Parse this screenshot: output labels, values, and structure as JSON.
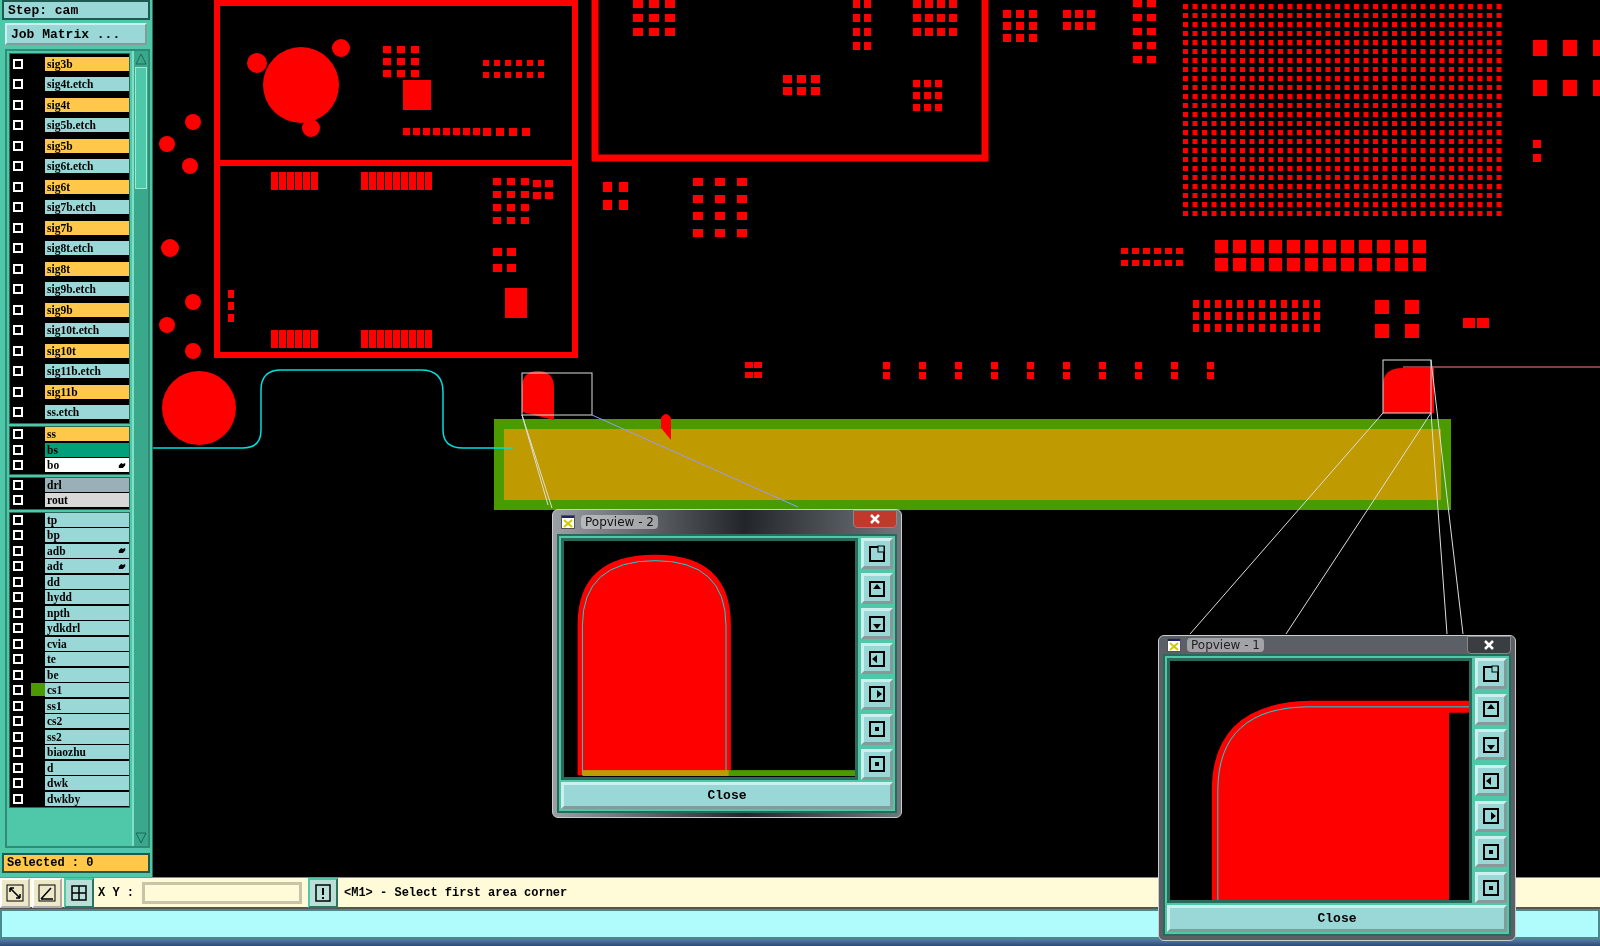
{
  "step_label": "Step: cam",
  "job_matrix_button": "Job Matrix ...",
  "layer_groups": [
    {
      "layers": [
        {
          "name": "sig3b",
          "color": "#ffc84a",
          "flag": false
        },
        {
          "name": "sig4t.etch",
          "color": "#9ad8d8",
          "flag": false
        },
        {
          "name": "sig4t",
          "color": "#ffc84a",
          "flag": false
        },
        {
          "name": "sig5b.etch",
          "color": "#9ad8d8",
          "flag": false
        },
        {
          "name": "sig5b",
          "color": "#ffc84a",
          "flag": false
        },
        {
          "name": "sig6t.etch",
          "color": "#9ad8d8",
          "flag": false
        },
        {
          "name": "sig6t",
          "color": "#ffc84a",
          "flag": false
        },
        {
          "name": "sig7b.etch",
          "color": "#9ad8d8",
          "flag": false
        },
        {
          "name": "sig7b",
          "color": "#ffc84a",
          "flag": false
        },
        {
          "name": "sig8t.etch",
          "color": "#9ad8d8",
          "flag": false
        },
        {
          "name": "sig8t",
          "color": "#ffc84a",
          "flag": false
        },
        {
          "name": "sig9b.etch",
          "color": "#9ad8d8",
          "flag": false
        },
        {
          "name": "sig9b",
          "color": "#ffc84a",
          "flag": false
        },
        {
          "name": "sig10t.etch",
          "color": "#9ad8d8",
          "flag": false
        },
        {
          "name": "sig10t",
          "color": "#ffc84a",
          "flag": false
        },
        {
          "name": "sig11b.etch",
          "color": "#9ad8d8",
          "flag": false
        },
        {
          "name": "sig11b",
          "color": "#ffc84a",
          "flag": false
        },
        {
          "name": "ss.etch",
          "color": "#9ad8d8",
          "flag": false
        }
      ]
    },
    {
      "layers": [
        {
          "name": "ss",
          "color": "#ffc84a",
          "flag": false
        },
        {
          "name": "bs",
          "color": "#00a07a",
          "flag": false
        },
        {
          "name": "bo",
          "color": "#ffffff",
          "flag": true
        }
      ]
    },
    {
      "layers": [
        {
          "name": "drl",
          "color": "#9ab0b8",
          "flag": false
        },
        {
          "name": "rout",
          "color": "#d8d8d8",
          "flag": false
        }
      ]
    },
    {
      "layers": [
        {
          "name": "tp",
          "color": "#9ad8d8",
          "flag": false
        },
        {
          "name": "bp",
          "color": "#9ad8d8",
          "flag": false
        },
        {
          "name": "adb",
          "color": "#9ad8d8",
          "flag": true
        },
        {
          "name": "adt",
          "color": "#9ad8d8",
          "flag": true
        },
        {
          "name": "dd",
          "color": "#9ad8d8",
          "flag": false
        },
        {
          "name": "hydd",
          "color": "#9ad8d8",
          "flag": false
        },
        {
          "name": "npth",
          "color": "#9ad8d8",
          "flag": false
        },
        {
          "name": "ydkdrl",
          "color": "#9ad8d8",
          "flag": false
        },
        {
          "name": "cvia",
          "color": "#9ad8d8",
          "flag": false
        },
        {
          "name": "te",
          "color": "#9ad8d8",
          "flag": false
        },
        {
          "name": "be",
          "color": "#9ad8d8",
          "flag": false
        },
        {
          "name": "cs1",
          "color": "#9ad8d8",
          "flag": false,
          "swatch": {
            "color": "#4a9a00"
          }
        },
        {
          "name": "ss1",
          "color": "#9ad8d8",
          "flag": false
        },
        {
          "name": "cs2",
          "color": "#9ad8d8",
          "flag": false
        },
        {
          "name": "ss2",
          "color": "#9ad8d8",
          "flag": false
        },
        {
          "name": "biaozhu",
          "color": "#9ad8d8",
          "flag": false
        },
        {
          "name": "d",
          "color": "#9ad8d8",
          "flag": false
        },
        {
          "name": "dwk",
          "color": "#9ad8d8",
          "flag": false
        },
        {
          "name": "dwkby",
          "color": "#9ad8d8",
          "flag": false
        }
      ]
    }
  ],
  "selected_count": "Selected : 0",
  "command_bar": {
    "xy_label": "X Y :",
    "prompt": "<M1> - Select first area corner"
  },
  "popviews": [
    {
      "title": "Popview - 2",
      "active": true,
      "kind": "arch",
      "close_button": "Close"
    },
    {
      "title": "Popview - 1",
      "active": false,
      "kind": "corner",
      "close_button": "Close"
    }
  ]
}
